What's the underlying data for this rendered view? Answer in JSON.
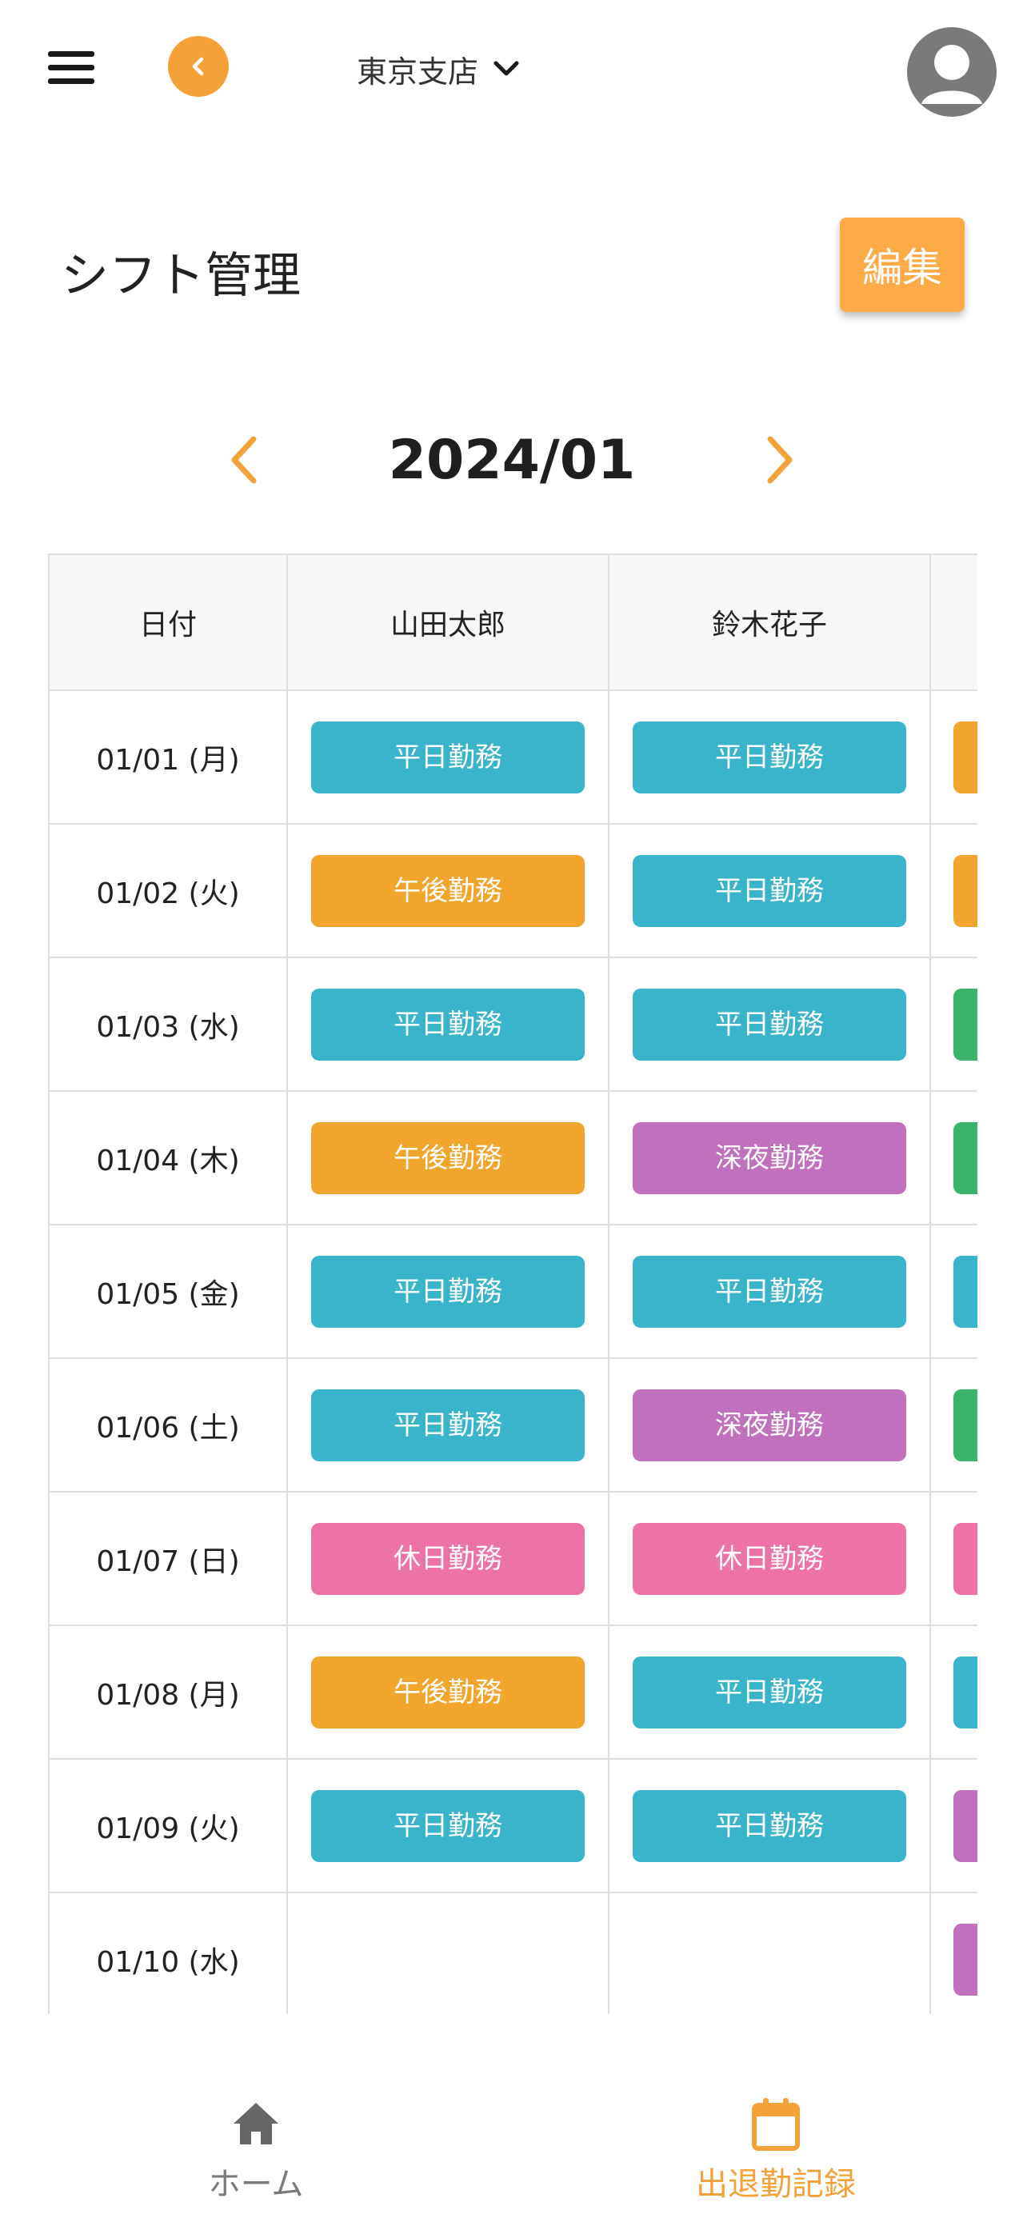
{
  "header": {
    "branch": "東京支店"
  },
  "page": {
    "title": "シフト管理",
    "edit_label": "編集"
  },
  "month_nav": {
    "current": "2024/01"
  },
  "colors": {
    "accent": "#f5a13a",
    "weekday": "#3ab4ca",
    "afternoon": "#f2a52c",
    "night": "#c070bc",
    "holiday": "#ec72a8",
    "green": "#3bb36a"
  },
  "table": {
    "headers": [
      "日付",
      "山田太郎",
      "鈴木花子",
      ""
    ],
    "rows": [
      {
        "date": "01/01 (月)",
        "s1": "平日勤務",
        "s1c": "#3ab4ca",
        "s2": "平日勤務",
        "s2c": "#3ab4ca",
        "s3c": "#f2a52c"
      },
      {
        "date": "01/02 (火)",
        "s1": "午後勤務",
        "s1c": "#f2a52c",
        "s2": "平日勤務",
        "s2c": "#3ab4ca",
        "s3c": "#f2a52c"
      },
      {
        "date": "01/03 (水)",
        "s1": "平日勤務",
        "s1c": "#3ab4ca",
        "s2": "平日勤務",
        "s2c": "#3ab4ca",
        "s3c": "#3bb36a"
      },
      {
        "date": "01/04 (木)",
        "s1": "午後勤務",
        "s1c": "#f2a52c",
        "s2": "深夜勤務",
        "s2c": "#c070bc",
        "s3c": "#3bb36a"
      },
      {
        "date": "01/05 (金)",
        "s1": "平日勤務",
        "s1c": "#3ab4ca",
        "s2": "平日勤務",
        "s2c": "#3ab4ca",
        "s3c": "#3ab4ca"
      },
      {
        "date": "01/06 (土)",
        "s1": "平日勤務",
        "s1c": "#3ab4ca",
        "s2": "深夜勤務",
        "s2c": "#c070bc",
        "s3c": "#3bb36a"
      },
      {
        "date": "01/07 (日)",
        "s1": "休日勤務",
        "s1c": "#ec72a8",
        "s2": "休日勤務",
        "s2c": "#ec72a8",
        "s3c": "#ec72a8"
      },
      {
        "date": "01/08 (月)",
        "s1": "午後勤務",
        "s1c": "#f2a52c",
        "s2": "平日勤務",
        "s2c": "#3ab4ca",
        "s3c": "#3ab4ca"
      },
      {
        "date": "01/09 (火)",
        "s1": "平日勤務",
        "s1c": "#3ab4ca",
        "s2": "平日勤務",
        "s2c": "#3ab4ca",
        "s3c": "#c070bc"
      },
      {
        "date": "01/10 (水)",
        "s1": "",
        "s1c": "",
        "s2": "",
        "s2c": "",
        "s3c": "#c070bc"
      }
    ]
  },
  "bottom_nav": {
    "home": "ホーム",
    "attendance": "出退勤記録"
  }
}
